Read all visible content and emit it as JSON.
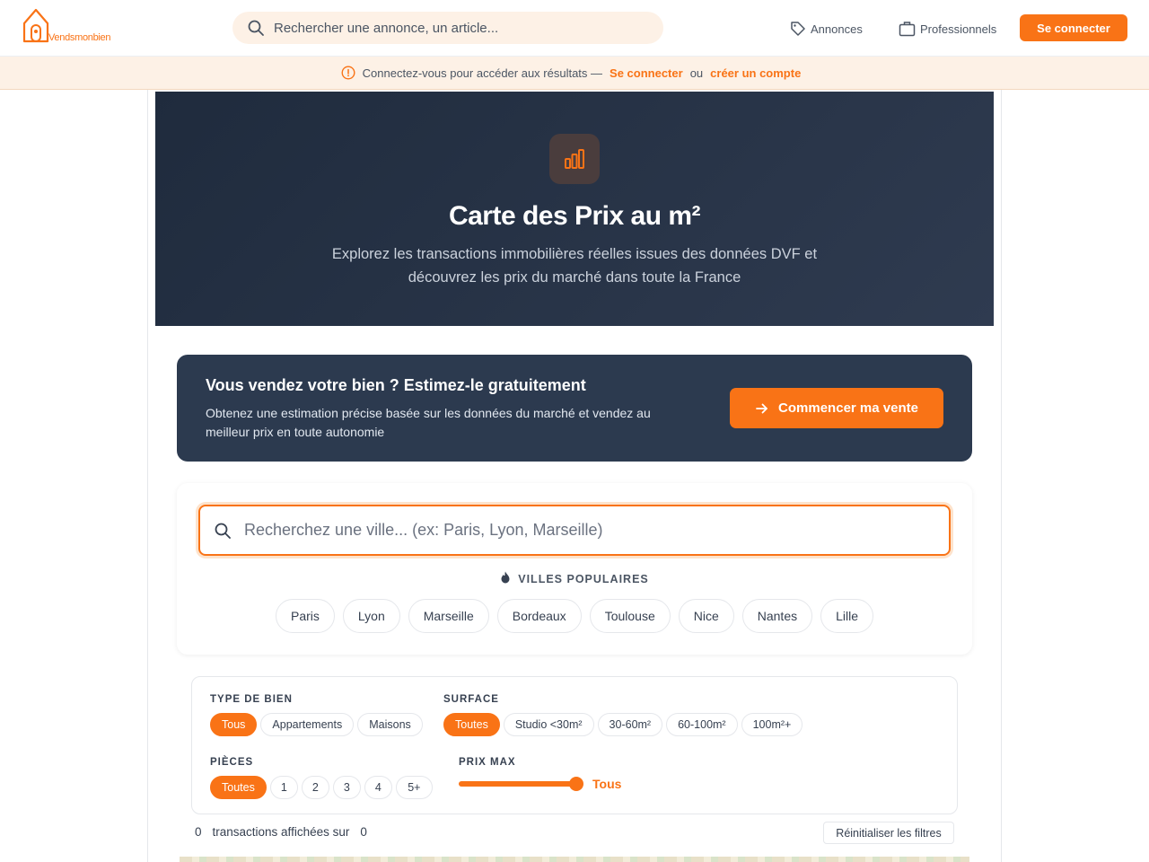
{
  "brand": {
    "name": "Vendsmonbien",
    "accent": "#f97316"
  },
  "header": {
    "search_placeholder": "Rechercher une annonce, un article...",
    "nav": [
      {
        "label": "Annonces",
        "icon": "tag-icon"
      },
      {
        "label": "Professionnels",
        "icon": "briefcase-icon"
      }
    ],
    "login_label": "Se connecter"
  },
  "notice": {
    "text": "Connectez-vous pour accéder aux résultats —",
    "login_link": "Se connecter",
    "or": "ou",
    "signup_link": "créer un compte"
  },
  "hero": {
    "icon": "bar-chart-icon",
    "title": "Carte des Prix au m²",
    "subtitle": "Explorez les transactions immobilières réelles issues des données DVF et découvrez les prix du marché dans toute la France"
  },
  "sell_banner": {
    "title": "Vous vendez votre bien ? Estimez-le gratuitement",
    "description": "Obtenez une estimation précise basée sur les données du marché et vendez au meilleur prix en toute autonomie",
    "button_label": "Commencer ma vente"
  },
  "city_search": {
    "placeholder": "Recherchez une ville... (ex: Paris, Lyon, Marseille)",
    "popular_label": "VILLES POPULAIRES",
    "cities": [
      "Paris",
      "Lyon",
      "Marseille",
      "Bordeaux",
      "Toulouse",
      "Nice",
      "Nantes",
      "Lille"
    ]
  },
  "filters": {
    "type": {
      "label": "TYPE DE BIEN",
      "options": [
        "Tous",
        "Appartements",
        "Maisons"
      ],
      "selected": "Tous"
    },
    "surface": {
      "label": "SURFACE",
      "options": [
        "Toutes",
        "Studio <30m²",
        "30-60m²",
        "60-100m²",
        "100m²+"
      ],
      "selected": "Toutes"
    },
    "rooms": {
      "label": "PIÈCES",
      "options": [
        "Toutes",
        "1",
        "2",
        "3",
        "4",
        "5+"
      ],
      "selected": "Toutes"
    },
    "price": {
      "label": "PRIX MAX",
      "value_label": "Tous",
      "slider_level": 1.0
    }
  },
  "results": {
    "shown": "0",
    "text": "transactions affichées sur",
    "total": "0",
    "reset_label": "Réinitialiser les filtres"
  }
}
